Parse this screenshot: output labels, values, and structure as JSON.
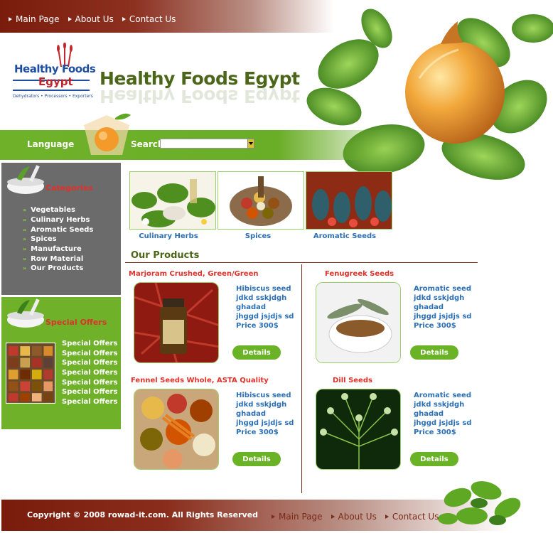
{
  "nav": {
    "items": [
      "Main Page",
      "About Us",
      "Contact Us"
    ]
  },
  "logo": {
    "word1": "Healthy",
    "word2": "Foods",
    "word3": "Egypt",
    "tagline": "Dehydrators • Processors • Exporters"
  },
  "site_title": "Healthy Foods Egypt",
  "search_bar": {
    "language_label": "Language",
    "search_label": "Search",
    "search_value": ""
  },
  "sidebar": {
    "categories_title": "Categories",
    "categories": [
      "Vegetables",
      "Culinary Herbs",
      "Aromatic Seeds",
      "Spices",
      "Manufacture",
      "Row Material",
      "Our Products"
    ],
    "special_offers_title": "Special Offers",
    "special_offers": [
      "Special Offers",
      "Special Offers",
      "Special Offers",
      "Special Offers",
      "Special Offers",
      "Special Offers",
      "Special Offers"
    ]
  },
  "category_tiles": [
    "Culinary Herbs",
    "Spices",
    "Aromatic Seeds"
  ],
  "products_title": "Our Products",
  "products": [
    {
      "name": "Marjoram Crushed, Green/Green",
      "desc": [
        "Hibiscus seed",
        "jdkd sskjdgh",
        "ghadad",
        "jhggd jsjdjs sd",
        "Price 300$"
      ],
      "button": "Details"
    },
    {
      "name": "Fenugreek Seeds",
      "desc": [
        "Aromatic seed",
        "jdkd sskjdgh",
        "ghadad",
        "jhggd jsjdjs sd",
        "Price 300$"
      ],
      "button": "Details"
    },
    {
      "name": "Fennel Seeds Whole, ASTA Quality",
      "desc": [
        "Hibiscus seed",
        "jdkd sskjdgh",
        "ghadad",
        "jhggd jsjdjs sd",
        "Price 300$"
      ],
      "button": "Details"
    },
    {
      "name": "Dill Seeds",
      "desc": [
        "Aromatic seed",
        "jdkd sskjdgh",
        "ghadad",
        "jhggd jsjdjs sd",
        "Price 300$"
      ],
      "button": "Details"
    }
  ],
  "footer": {
    "copyright": "Copyright © 2008 rowad-it.com. All Rights Reserved",
    "nav": [
      "Main Page",
      "About Us",
      "Contact Us"
    ]
  },
  "colors": {
    "brand_green": "#6fb22a",
    "brand_brown": "#7a1c0c",
    "title_green": "#4b6618",
    "accent_red": "#e0312a",
    "link_blue": "#2c6fb5"
  }
}
